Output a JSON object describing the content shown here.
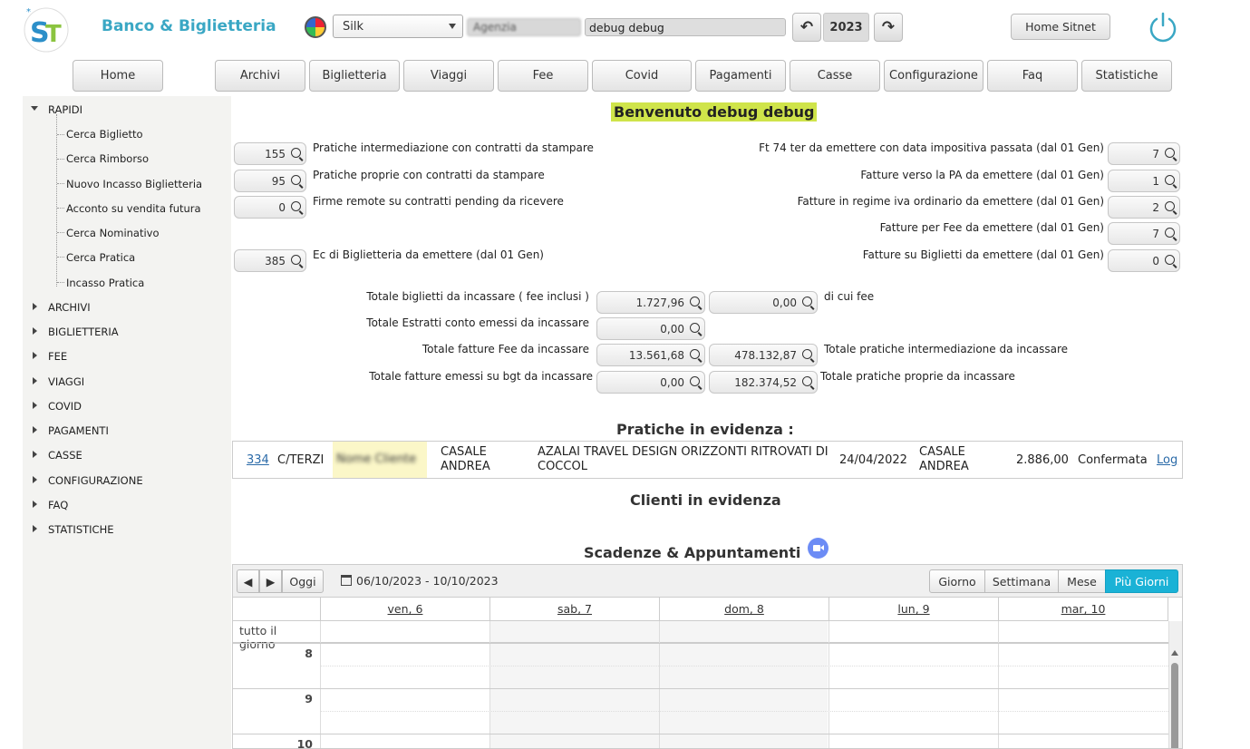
{
  "header": {
    "app_title": "Banco & Biglietteria",
    "theme_select": "Silk",
    "blurred_field": "Agenzia",
    "user_field": "debug debug",
    "year": "2023",
    "home_sitnet": "Home Sitnet"
  },
  "menu": {
    "home": "Home",
    "items": [
      "Archivi",
      "Biglietteria",
      "Viaggi",
      "Fee",
      "Covid",
      "Pagamenti",
      "Casse",
      "Configurazione",
      "Faq",
      "Statistiche"
    ]
  },
  "sidebar": {
    "rapidi": "RAPIDI",
    "rapidi_items": [
      "Cerca Biglietto",
      "Cerca Rimborso",
      "Nuovo Incasso Biglietteria",
      "Acconto su vendita futura",
      "Cerca Nominativo",
      "Cerca Pratica",
      "Incasso Pratica"
    ],
    "groups": [
      "ARCHIVI",
      "BIGLIETTERIA",
      "FEE",
      "VIAGGI",
      "COVID",
      "PAGAMENTI",
      "CASSE",
      "CONFIGURAZIONE",
      "FAQ",
      "STATISTICHE"
    ]
  },
  "welcome": "Benvenuto debug debug",
  "left_counts": [
    {
      "value": "155",
      "label": "Pratiche intermediazione con contratti da stampare"
    },
    {
      "value": "95",
      "label": "Pratiche proprie con contratti da stampare"
    },
    {
      "value": "0",
      "label": "Firme remote su contratti pending da ricevere"
    },
    {
      "value": "385",
      "label": "Ec di Biglietteria da emettere (dal 01 Gen)"
    }
  ],
  "right_counts": [
    {
      "value": "7",
      "label": "Ft 74 ter da emettere con data impositiva passata (dal 01 Gen)"
    },
    {
      "value": "1",
      "label": "Fatture verso  la PA da emettere (dal 01 Gen)"
    },
    {
      "value": "2",
      "label": "Fatture in regime iva ordinario da emettere (dal 01 Gen)"
    },
    {
      "value": "7",
      "label": "Fatture per Fee da emettere (dal 01 Gen)"
    },
    {
      "value": "0",
      "label": "Fatture su Biglietti da emettere (dal 01 Gen)"
    }
  ],
  "totals": {
    "row1_label": "Totale biglietti da incassare ( fee inclusi )",
    "row1_value": "1.727,96",
    "row1_value2": "0,00",
    "row1_right": "di cui fee",
    "row2_label": "Totale Estratti conto emessi da incassare",
    "row2_value": "0,00",
    "row3_label": "Totale fatture Fee da incassare",
    "row3_value": "13.561,68",
    "row3_value2": "478.132,87",
    "row3_right": "Totale pratiche intermediazione da incassare",
    "row4_label": "Totale fatture emessi su bgt da incassare",
    "row4_value": "0,00",
    "row4_value2": "182.374,52",
    "row4_right": "Totale pratiche proprie da incassare"
  },
  "pratiche": {
    "title": "Pratiche in evidenza :",
    "row": {
      "number": "334",
      "type": "C/TERZI",
      "blurred": "Nome Cliente",
      "operator": "CASALE ANDREA",
      "description": "AZALAI TRAVEL DESIGN ORIZZONTI RITROVATI DI COCCOL",
      "date": "24/04/2022",
      "operator2": "CASALE ANDREA",
      "amount": "2.886,00",
      "status": "Confermata",
      "log": "Log"
    }
  },
  "clienti_title": "Clienti in evidenza",
  "scadenze_title": "Scadenze & Appuntamenti",
  "calendar": {
    "today": "Oggi",
    "range": "06/10/2023 - 10/10/2023",
    "views": [
      "Giorno",
      "Settimana",
      "Mese",
      "Più Giorni"
    ],
    "active_view": "Più Giorni",
    "days": [
      "ven, 6",
      "sab, 7",
      "dom, 8",
      "lun, 9",
      "mar, 10"
    ],
    "allday": "tutto il giorno",
    "hours": [
      "8",
      "9",
      "10"
    ]
  },
  "colors": {
    "brand": "#3aa7c4",
    "welcome_bg": "#cfe44a",
    "active_view": "#1ab2d6"
  }
}
